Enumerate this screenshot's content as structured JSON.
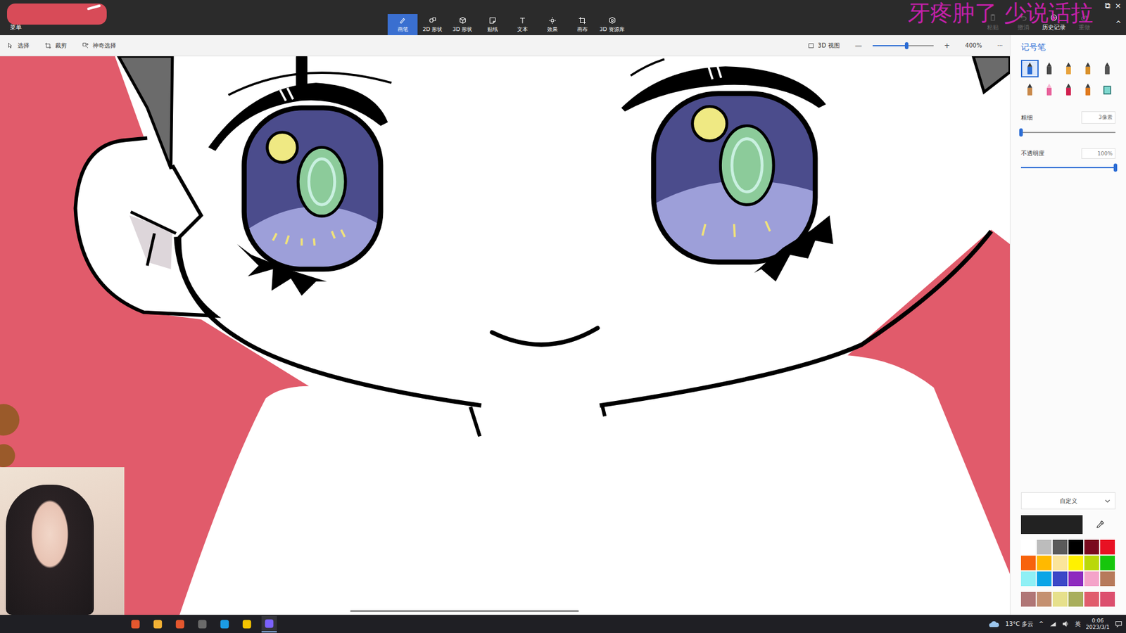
{
  "app": {
    "menu": "菜单",
    "window_buttons": [
      "⧉",
      "×"
    ],
    "collapse": "^"
  },
  "overlay": {
    "text": "牙疼肿了 少说话拉"
  },
  "tabs": [
    {
      "label": "画笔",
      "selected": true
    },
    {
      "label": "2D 形状",
      "selected": false
    },
    {
      "label": "3D 形状",
      "selected": false
    },
    {
      "label": "贴纸",
      "selected": false
    },
    {
      "label": "文本",
      "selected": false
    },
    {
      "label": "效果",
      "selected": false
    },
    {
      "label": "画布",
      "selected": false
    },
    {
      "label": "3D 资源库",
      "selected": false
    }
  ],
  "actions": [
    {
      "label": "粘贴",
      "disabled": true
    },
    {
      "label": "撤消",
      "disabled": true
    },
    {
      "label": "历史记录",
      "disabled": false
    },
    {
      "label": "重做",
      "disabled": true
    }
  ],
  "subtoolbar": {
    "tools": [
      {
        "label": "选择"
      },
      {
        "label": "裁剪"
      },
      {
        "label": "神奇选择"
      }
    ],
    "view_3d": "3D 视图",
    "zoom_out": "—",
    "zoom_in": "+",
    "zoom": {
      "level": 0.56,
      "reading": "400%"
    },
    "more": "···"
  },
  "panel": {
    "title": "记号笔",
    "brushes": [
      {
        "kind": "marker",
        "selected": true
      },
      {
        "kind": "calligraphy",
        "selected": false
      },
      {
        "kind": "oil",
        "selected": false
      },
      {
        "kind": "watercolor",
        "selected": false
      },
      {
        "kind": "pixel",
        "selected": false
      },
      {
        "kind": "pencil",
        "selected": false
      },
      {
        "kind": "eraser",
        "selected": false
      },
      {
        "kind": "crayon",
        "selected": false
      },
      {
        "kind": "spray",
        "selected": false
      },
      {
        "kind": "fill",
        "selected": false
      }
    ],
    "thickness": {
      "label": "粗细",
      "value": "3像素",
      "level": 0.0
    },
    "opacity": {
      "label": "不透明度",
      "value": "100%",
      "level": 1.0
    },
    "color_mode": "自定义",
    "current_color": "#222222",
    "palette": [
      {
        "color": "#ffffff"
      },
      {
        "color": "#bcbcbc"
      },
      {
        "color": "#5a5a5a"
      },
      {
        "color": "#000000"
      },
      {
        "color": "#7a0a1e"
      },
      {
        "color": "#e81123"
      },
      {
        "color": "#f7630c"
      },
      {
        "color": "#ffb900"
      },
      {
        "color": "#fbe59b"
      },
      {
        "color": "#fff100"
      },
      {
        "color": "#bad80a"
      },
      {
        "color": "#16c60c"
      },
      {
        "color": "#8ff0f5"
      },
      {
        "color": "#0ba5e6"
      },
      {
        "color": "#3b47c7"
      },
      {
        "color": "#8e2bbf"
      },
      {
        "color": "#f4a3c9"
      },
      {
        "color": "#b77a5b"
      },
      {
        "color": "#b07676"
      },
      {
        "color": "#c49070"
      },
      {
        "color": "#e6e08c"
      },
      {
        "color": "#a8ae5c"
      },
      {
        "color": "#e05c6c"
      },
      {
        "color": "#dc4f6e"
      }
    ]
  },
  "taskbar": {
    "apps": [
      {
        "active": false
      },
      {
        "active": false
      },
      {
        "active": false
      },
      {
        "active": false
      },
      {
        "active": false
      },
      {
        "active": false
      },
      {
        "active": true
      }
    ],
    "weather": "13°C 多云",
    "chevron": "^",
    "ime": "英",
    "time": "0:06",
    "date": "2023/3/1"
  }
}
